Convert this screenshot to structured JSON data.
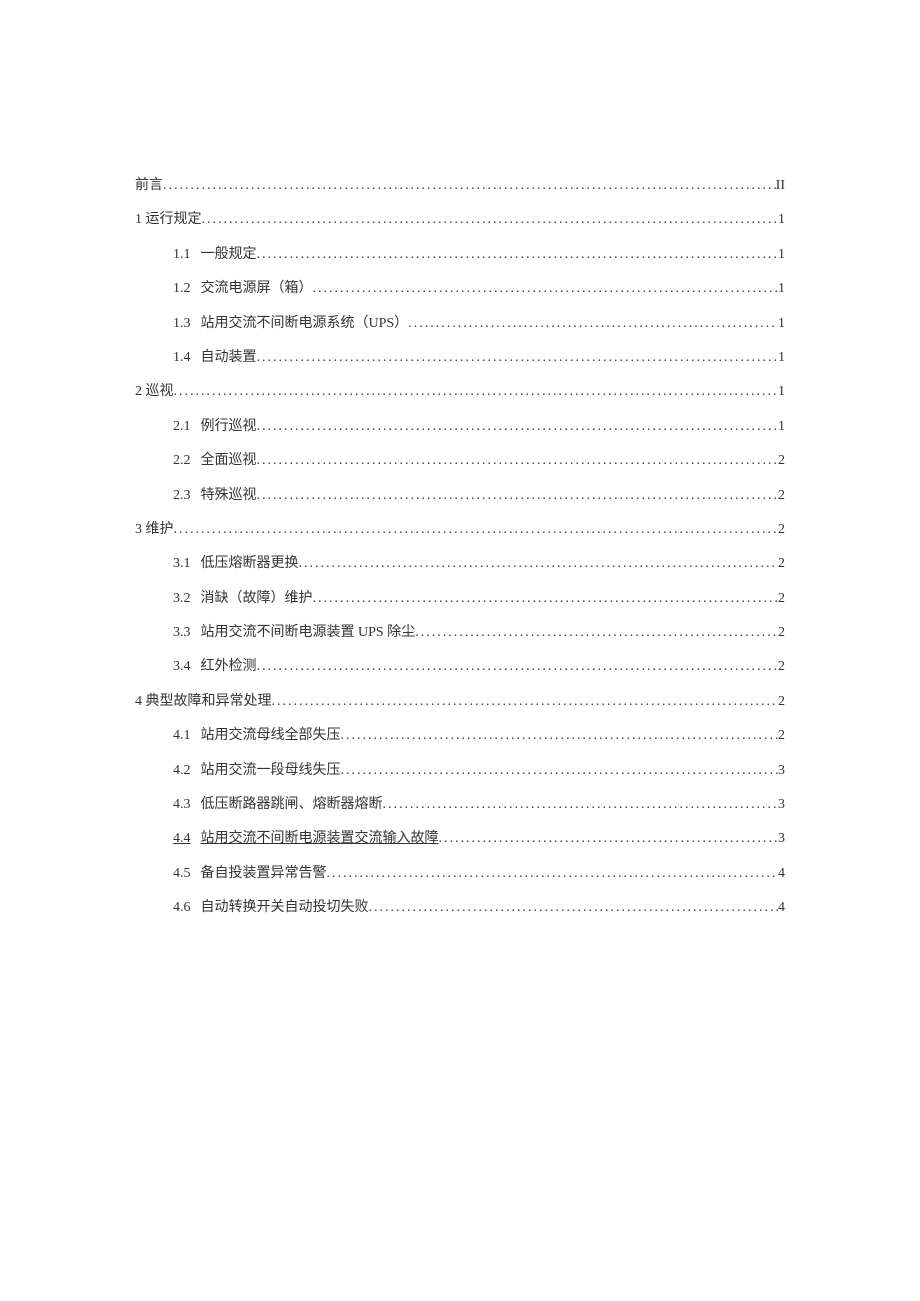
{
  "toc": [
    {
      "level": 1,
      "num": "",
      "title": "前言",
      "page": "II",
      "linked": false
    },
    {
      "level": 1,
      "num": "1",
      "title": "运行规定",
      "page": "1",
      "linked": false
    },
    {
      "level": 2,
      "num": "1.1",
      "title": "一般规定",
      "page": "1",
      "linked": false
    },
    {
      "level": 2,
      "num": "1.2",
      "title": "交流电源屏（箱）",
      "page": "1",
      "linked": false
    },
    {
      "level": 2,
      "num": "1.3",
      "title": "站用交流不间断电源系统（UPS）",
      "page": "1",
      "linked": false
    },
    {
      "level": 2,
      "num": "1.4",
      "title": "自动装置",
      "page": "1",
      "linked": false
    },
    {
      "level": 1,
      "num": "2",
      "title": "巡视",
      "page": "1",
      "linked": false
    },
    {
      "level": 2,
      "num": "2.1",
      "title": "例行巡视",
      "page": "1",
      "linked": false
    },
    {
      "level": 2,
      "num": "2.2",
      "title": "全面巡视",
      "page": "2",
      "linked": false
    },
    {
      "level": 2,
      "num": "2.3",
      "title": "特殊巡视",
      "page": "2",
      "linked": false
    },
    {
      "level": 1,
      "num": "3",
      "title": "维护",
      "page": "2",
      "linked": false
    },
    {
      "level": 2,
      "num": "3.1",
      "title": "低压熔断器更换",
      "page": "2",
      "linked": false
    },
    {
      "level": 2,
      "num": "3.2",
      "title": "消缺（故障）维护",
      "page": "2",
      "linked": false
    },
    {
      "level": 2,
      "num": "3.3",
      "title": "站用交流不间断电源装置 UPS 除尘",
      "page": "2",
      "linked": false
    },
    {
      "level": 2,
      "num": "3.4",
      "title": "红外检测",
      "page": "2",
      "linked": false
    },
    {
      "level": 1,
      "num": "4",
      "title": "典型故障和异常处理",
      "page": "2",
      "linked": false
    },
    {
      "level": 2,
      "num": "4.1",
      "title": "站用交流母线全部失压",
      "page": "2",
      "linked": false
    },
    {
      "level": 2,
      "num": "4.2",
      "title": "站用交流一段母线失压",
      "page": "3",
      "linked": false
    },
    {
      "level": 2,
      "num": "4.3",
      "title": "低压断路器跳闸、熔断器熔断",
      "page": "3",
      "linked": false
    },
    {
      "level": 2,
      "num": "4.4",
      "title": "站用交流不间断电源装置交流输入故障",
      "page": "3",
      "linked": true
    },
    {
      "level": 2,
      "num": "4.5",
      "title": "备自投装置异常告警",
      "page": "4",
      "linked": false
    },
    {
      "level": 2,
      "num": "4.6",
      "title": "自动转换开关自动投切失败",
      "page": "4",
      "linked": false
    }
  ]
}
